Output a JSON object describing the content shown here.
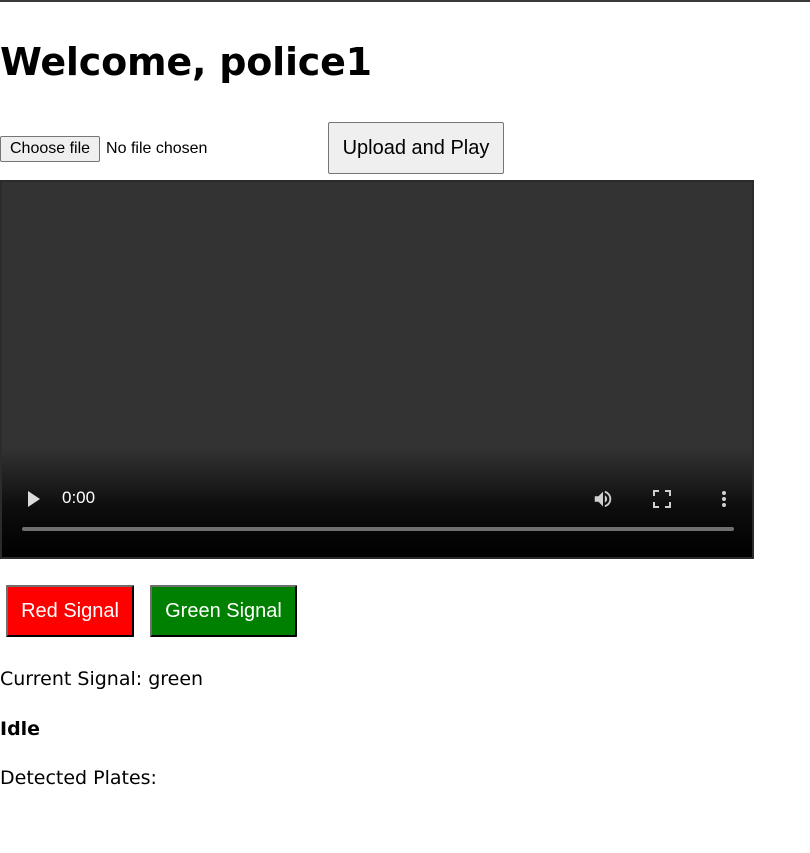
{
  "page": {
    "title": "Welcome, police1"
  },
  "upload": {
    "choose_file_label": "Choose file",
    "file_status": "No file chosen",
    "upload_button_label": "Upload and Play"
  },
  "video": {
    "time": "0:00",
    "progress": 0,
    "icons": [
      "play-icon",
      "volume-icon",
      "fullscreen-icon",
      "more-options-icon"
    ]
  },
  "signals": {
    "red_label": "Red Signal",
    "green_label": "Green Signal",
    "red_color": "#ff0000",
    "green_color": "#008000"
  },
  "status": {
    "current_signal": "Current Signal: green",
    "detector_state": "Idle",
    "plates_label": "Detected Plates:"
  }
}
